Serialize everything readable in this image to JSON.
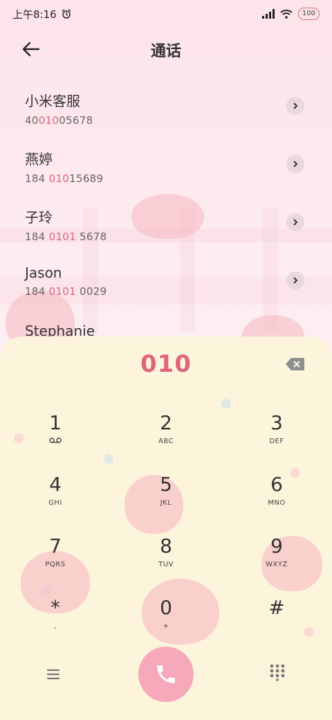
{
  "status": {
    "time": "上午8:16",
    "battery": "100"
  },
  "header": {
    "title": "通话"
  },
  "contacts": [
    {
      "name": "小米客服",
      "num_pre": "40",
      "num_hl": "010",
      "num_post": "05678"
    },
    {
      "name": "燕婷",
      "num_pre": "184 ",
      "num_hl": "010",
      "num_post": "15689"
    },
    {
      "name": "子玲",
      "num_pre": "184 ",
      "num_hl": "0101",
      "num_post": " 5678"
    },
    {
      "name": "Jason",
      "num_pre": "184 ",
      "num_hl": "0101",
      "num_post": " 0029"
    },
    {
      "name": "Stephanie",
      "num_pre": "",
      "num_hl": "",
      "num_post": ""
    }
  ],
  "dialer": {
    "entered": "010",
    "keys": [
      {
        "digit": "1",
        "letters": ""
      },
      {
        "digit": "2",
        "letters": "ABC"
      },
      {
        "digit": "3",
        "letters": "DEF"
      },
      {
        "digit": "4",
        "letters": "GHI"
      },
      {
        "digit": "5",
        "letters": "JKL"
      },
      {
        "digit": "6",
        "letters": "MNO"
      },
      {
        "digit": "7",
        "letters": "PQRS"
      },
      {
        "digit": "8",
        "letters": "TUV"
      },
      {
        "digit": "9",
        "letters": "WXYZ"
      },
      {
        "digit": "*",
        "letters": ","
      },
      {
        "digit": "0",
        "letters": "+"
      },
      {
        "digit": "#",
        "letters": ""
      }
    ]
  },
  "colors": {
    "accent": "#e0647b",
    "call": "#f6a9bb",
    "pad_bg": "#fdf4dc"
  },
  "icons": {
    "back": "arrow-left-icon",
    "chevron": "chevron-right-icon",
    "backspace": "backspace-icon",
    "voicemail": "voicemail-icon",
    "menu": "menu-icon",
    "call": "phone-icon",
    "dialpad": "dialpad-icon"
  }
}
